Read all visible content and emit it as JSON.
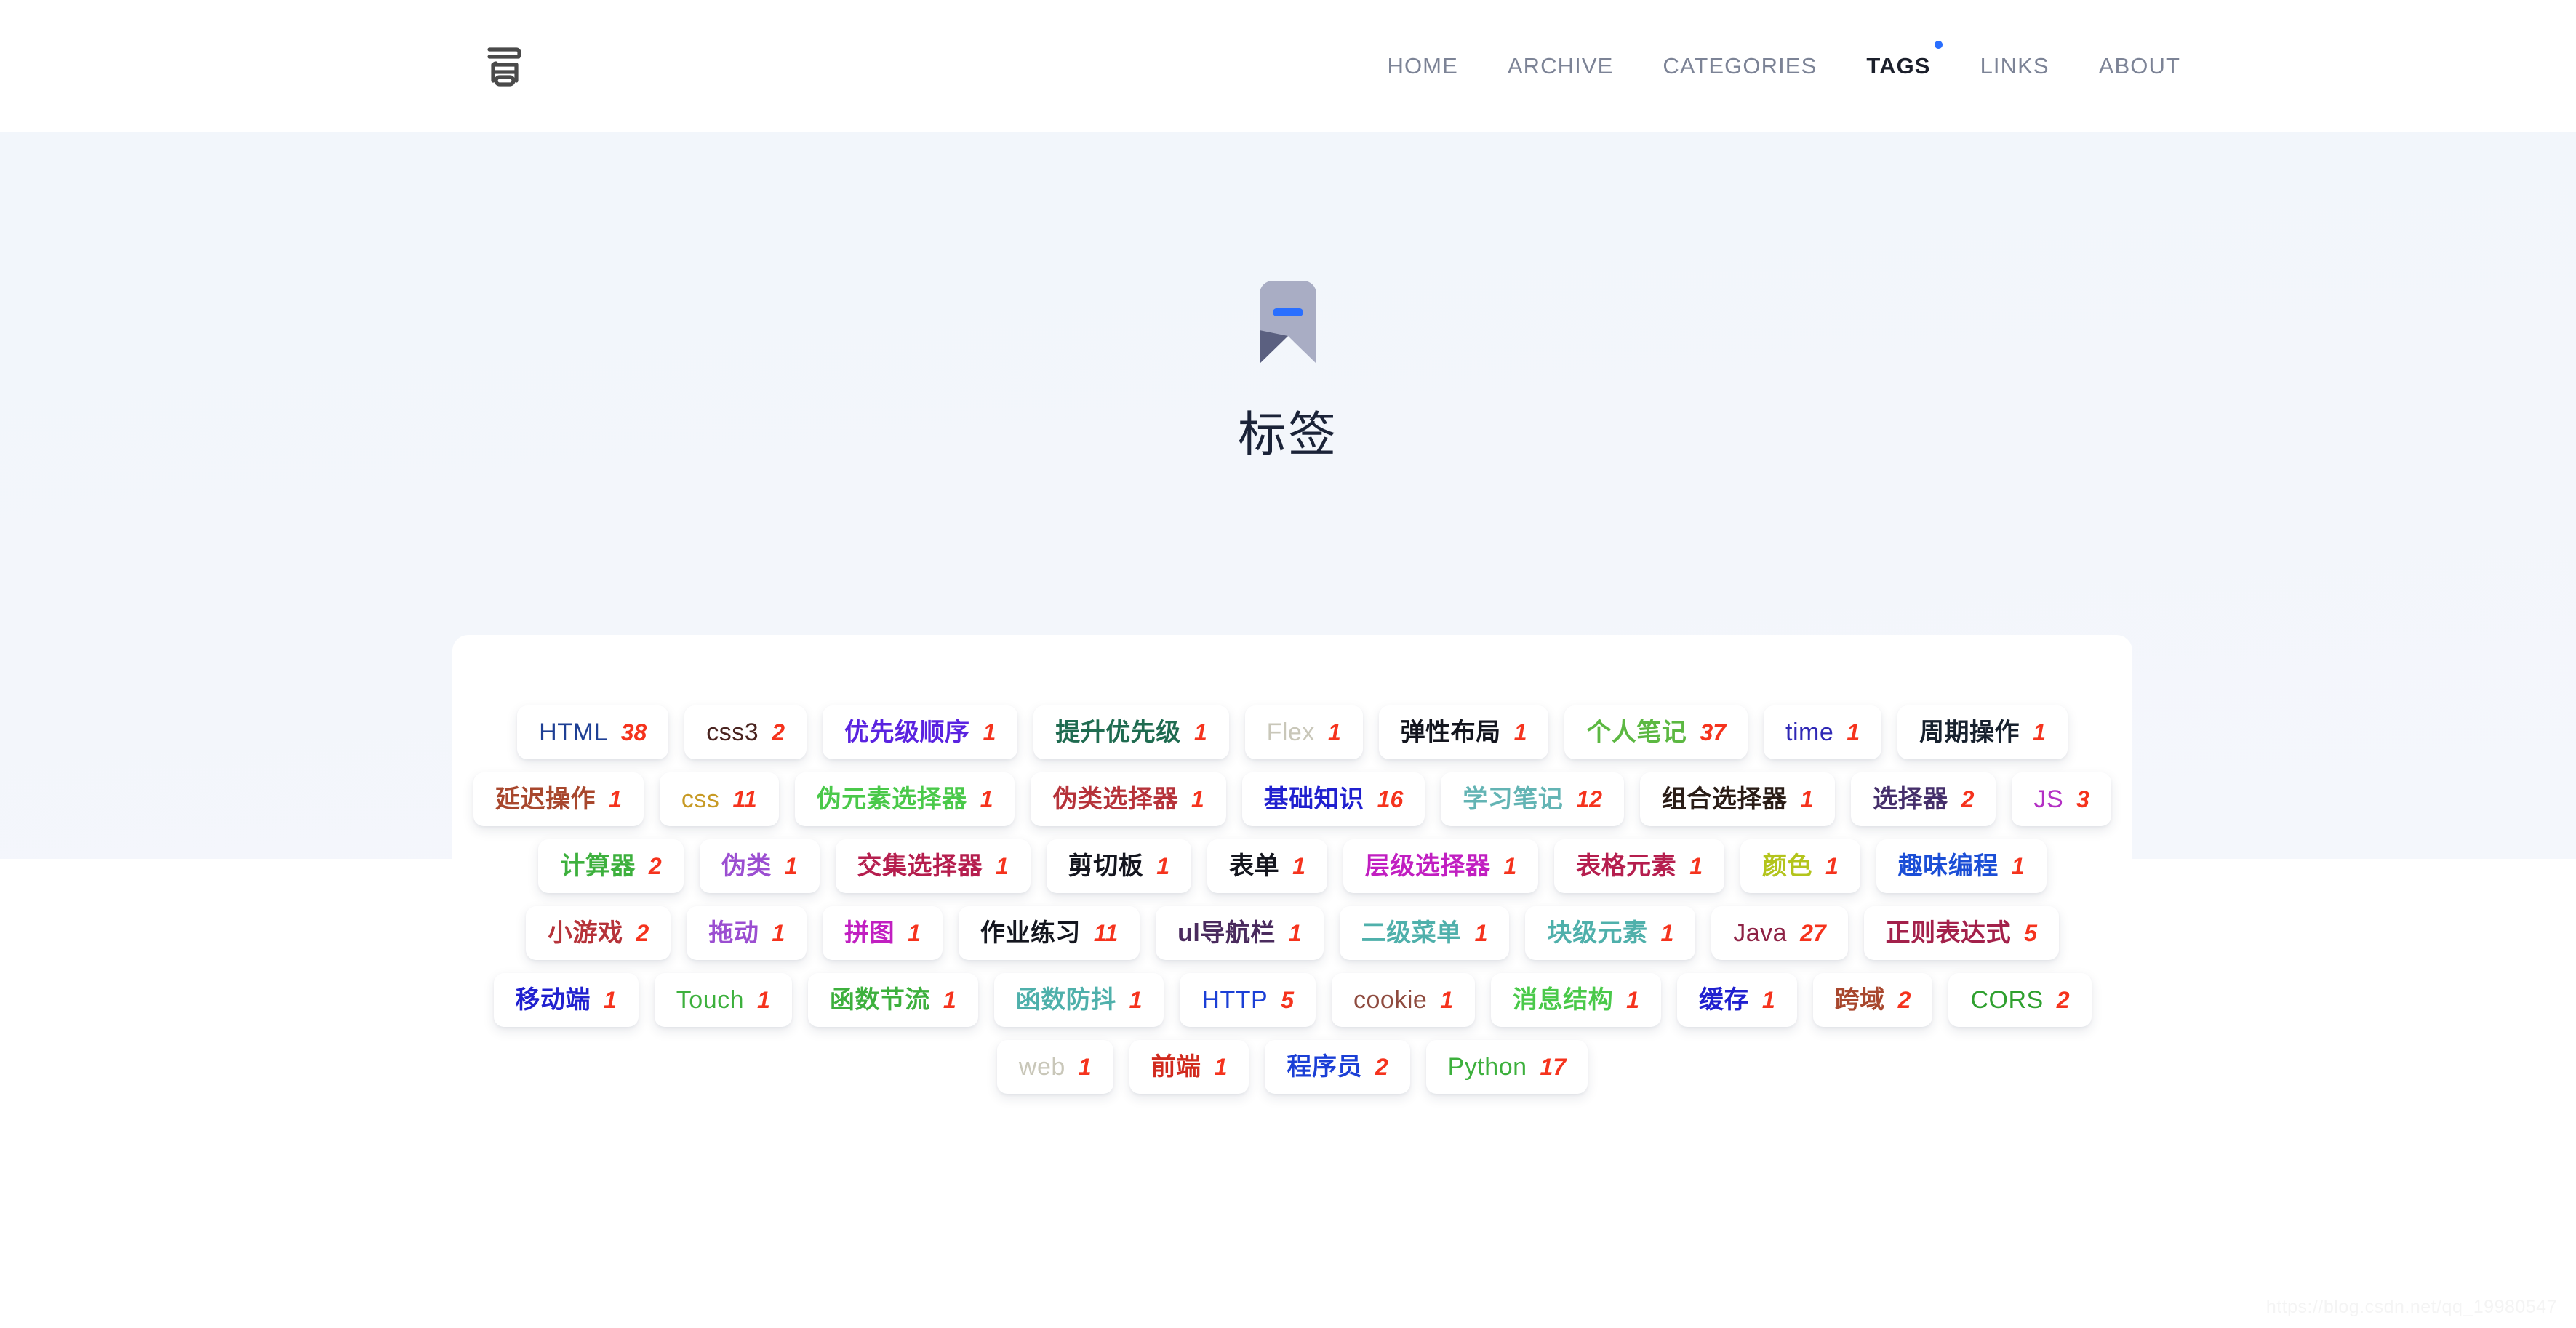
{
  "nav": {
    "logo_alt": "site-logo",
    "items": [
      {
        "label": "HOME",
        "active": false,
        "dot": false
      },
      {
        "label": "ARCHIVE",
        "active": false,
        "dot": false
      },
      {
        "label": "CATEGORIES",
        "active": false,
        "dot": false
      },
      {
        "label": "TAGS",
        "active": true,
        "dot": true
      },
      {
        "label": "LINKS",
        "active": false,
        "dot": false
      },
      {
        "label": "ABOUT",
        "active": false,
        "dot": false
      }
    ]
  },
  "hero": {
    "icon": "bookmark-tag-icon",
    "title": "标签",
    "icon_colors": {
      "body": "#a9adc4",
      "fold": "#5b6080",
      "dash": "#2a6fff"
    }
  },
  "colors": {
    "page_bg": "#ffffff",
    "hero_bg_top": "#f2f6fb",
    "hero_bg_bottom": "#f4f7fc",
    "card_bg": "#ffffff",
    "nav_inactive": "#7c8396",
    "nav_active": "#1b1f2b",
    "accent_dot": "#2a6fff",
    "default_count": "#f5331d",
    "title": "#1b2338",
    "watermark": "#f4f4f4"
  },
  "tags": [
    {
      "name": "HTML",
      "count": "38",
      "color": "#1e3f94",
      "count_color": "#f5331d",
      "latin": true
    },
    {
      "name": "css3",
      "count": "2",
      "color": "#4a2420",
      "count_color": "#f5331d",
      "latin": true
    },
    {
      "name": "优先级顺序",
      "count": "1",
      "color": "#5a23e0",
      "count_color": "#f5331d",
      "latin": false
    },
    {
      "name": "提升优先级",
      "count": "1",
      "color": "#1f6b50",
      "count_color": "#f5331d",
      "latin": false
    },
    {
      "name": "Flex",
      "count": "1",
      "color": "#c9c7b9",
      "count_color": "#f5331d",
      "latin": true
    },
    {
      "name": "弹性布局",
      "count": "1",
      "color": "#14161f",
      "count_color": "#f5331d",
      "latin": false
    },
    {
      "name": "个人笔记",
      "count": "37",
      "color": "#5cb842",
      "count_color": "#f5331d",
      "latin": false
    },
    {
      "name": "time",
      "count": "1",
      "color": "#2f28b5",
      "count_color": "#f5331d",
      "latin": true
    },
    {
      "name": "周期操作",
      "count": "1",
      "color": "#17212e",
      "count_color": "#f5331d",
      "latin": false
    },
    {
      "name": "延迟操作",
      "count": "1",
      "color": "#a8472d",
      "count_color": "#f5331d",
      "latin": false
    },
    {
      "name": "css",
      "count": "11",
      "color": "#c79a24",
      "count_color": "#f5331d",
      "latin": true
    },
    {
      "name": "伪元素选择器",
      "count": "1",
      "color": "#4ac94a",
      "count_color": "#f5331d",
      "latin": false
    },
    {
      "name": "伪类选择器",
      "count": "1",
      "color": "#b6333a",
      "count_color": "#f5331d",
      "latin": false
    },
    {
      "name": "基础知识",
      "count": "16",
      "color": "#2020cf",
      "count_color": "#f5331d",
      "latin": false
    },
    {
      "name": "学习笔记",
      "count": "12",
      "color": "#63b4b4",
      "count_color": "#f5331d",
      "latin": false
    },
    {
      "name": "组合选择器",
      "count": "1",
      "color": "#2a1d17",
      "count_color": "#f5331d",
      "latin": false
    },
    {
      "name": "选择器",
      "count": "2",
      "color": "#452f6b",
      "count_color": "#f5331d",
      "latin": false
    },
    {
      "name": "JS",
      "count": "3",
      "color": "#b32fc4",
      "count_color": "#f5331d",
      "latin": true
    },
    {
      "name": "计算器",
      "count": "2",
      "color": "#3db03d",
      "count_color": "#f5331d",
      "latin": false
    },
    {
      "name": "伪类",
      "count": "1",
      "color": "#9b4ed1",
      "count_color": "#f5331d",
      "latin": false
    },
    {
      "name": "交集选择器",
      "count": "1",
      "color": "#b51e4e",
      "count_color": "#f5331d",
      "latin": false
    },
    {
      "name": "剪切板",
      "count": "1",
      "color": "#14161f",
      "count_color": "#f5331d",
      "latin": false
    },
    {
      "name": "表单",
      "count": "1",
      "color": "#14161f",
      "count_color": "#f5331d",
      "latin": false
    },
    {
      "name": "层级选择器",
      "count": "1",
      "color": "#c11fc1",
      "count_color": "#f5331d",
      "latin": false
    },
    {
      "name": "表格元素",
      "count": "1",
      "color": "#b51e4e",
      "count_color": "#f5331d",
      "latin": false
    },
    {
      "name": "颜色",
      "count": "1",
      "color": "#b3c41c",
      "count_color": "#f5331d",
      "latin": false
    },
    {
      "name": "趣味编程",
      "count": "1",
      "color": "#1b4ed6",
      "count_color": "#f5331d",
      "latin": false
    },
    {
      "name": "小游戏",
      "count": "2",
      "color": "#b6333a",
      "count_color": "#f5331d",
      "latin": false
    },
    {
      "name": "拖动",
      "count": "1",
      "color": "#9b4ed1",
      "count_color": "#f5331d",
      "latin": false
    },
    {
      "name": "拼图",
      "count": "1",
      "color": "#c11fc1",
      "count_color": "#f5331d",
      "latin": false
    },
    {
      "name": "作业练习",
      "count": "11",
      "color": "#14161f",
      "count_color": "#f5331d",
      "latin": false
    },
    {
      "name": "ul导航栏",
      "count": "1",
      "color": "#4a2b5e",
      "count_color": "#f5331d",
      "latin": false
    },
    {
      "name": "二级菜单",
      "count": "1",
      "color": "#4fb0ab",
      "count_color": "#f5331d",
      "latin": false
    },
    {
      "name": "块级元素",
      "count": "1",
      "color": "#4fb0ab",
      "count_color": "#f5331d",
      "latin": false
    },
    {
      "name": "Java",
      "count": "27",
      "color": "#8e2245",
      "count_color": "#f5331d",
      "latin": true
    },
    {
      "name": "正则表达式",
      "count": "5",
      "color": "#a3214b",
      "count_color": "#f5331d",
      "latin": false
    },
    {
      "name": "移动端",
      "count": "1",
      "color": "#2020cf",
      "count_color": "#f5331d",
      "latin": false
    },
    {
      "name": "Touch",
      "count": "1",
      "color": "#3db03d",
      "count_color": "#f5331d",
      "latin": true
    },
    {
      "name": "函数节流",
      "count": "1",
      "color": "#3db03d",
      "count_color": "#f5331d",
      "latin": false
    },
    {
      "name": "函数防抖",
      "count": "1",
      "color": "#4fb0ab",
      "count_color": "#f5331d",
      "latin": false
    },
    {
      "name": "HTTP",
      "count": "5",
      "color": "#1b3fd6",
      "count_color": "#f5331d",
      "latin": true
    },
    {
      "name": "cookie",
      "count": "1",
      "color": "#8e4a3e",
      "count_color": "#f5331d",
      "latin": true
    },
    {
      "name": "消息结构",
      "count": "1",
      "color": "#4ac94a",
      "count_color": "#f5331d",
      "latin": false
    },
    {
      "name": "缓存",
      "count": "1",
      "color": "#2020cf",
      "count_color": "#f5331d",
      "latin": false
    },
    {
      "name": "跨域",
      "count": "2",
      "color": "#a8472d",
      "count_color": "#f5331d",
      "latin": false
    },
    {
      "name": "CORS",
      "count": "2",
      "color": "#2fa02f",
      "count_color": "#f5331d",
      "latin": true
    },
    {
      "name": "web",
      "count": "1",
      "color": "#c9c7b9",
      "count_color": "#f5331d",
      "latin": true
    },
    {
      "name": "前端",
      "count": "1",
      "color": "#d12a1e",
      "count_color": "#f5331d",
      "latin": false
    },
    {
      "name": "程序员",
      "count": "2",
      "color": "#1b3fd6",
      "count_color": "#f5331d",
      "latin": false
    },
    {
      "name": "Python",
      "count": "17",
      "color": "#3db03d",
      "count_color": "#f5331d",
      "latin": true
    }
  ],
  "watermark": "https://blog.csdn.net/qq_19980547"
}
